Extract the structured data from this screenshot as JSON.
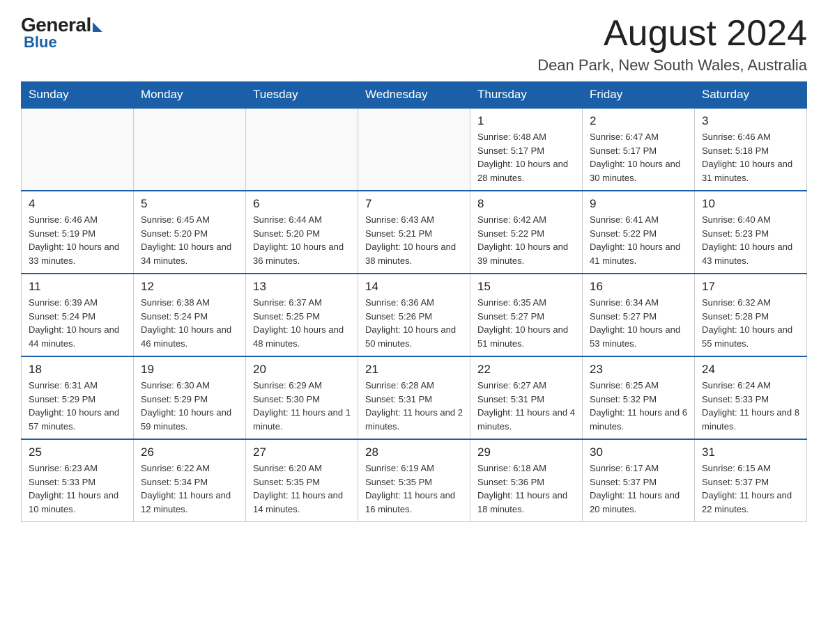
{
  "header": {
    "logo_general": "General",
    "logo_blue": "Blue",
    "month_title": "August 2024",
    "location": "Dean Park, New South Wales, Australia"
  },
  "days_of_week": [
    "Sunday",
    "Monday",
    "Tuesday",
    "Wednesday",
    "Thursday",
    "Friday",
    "Saturday"
  ],
  "weeks": [
    [
      {
        "day": "",
        "info": ""
      },
      {
        "day": "",
        "info": ""
      },
      {
        "day": "",
        "info": ""
      },
      {
        "day": "",
        "info": ""
      },
      {
        "day": "1",
        "info": "Sunrise: 6:48 AM\nSunset: 5:17 PM\nDaylight: 10 hours and 28 minutes."
      },
      {
        "day": "2",
        "info": "Sunrise: 6:47 AM\nSunset: 5:17 PM\nDaylight: 10 hours and 30 minutes."
      },
      {
        "day": "3",
        "info": "Sunrise: 6:46 AM\nSunset: 5:18 PM\nDaylight: 10 hours and 31 minutes."
      }
    ],
    [
      {
        "day": "4",
        "info": "Sunrise: 6:46 AM\nSunset: 5:19 PM\nDaylight: 10 hours and 33 minutes."
      },
      {
        "day": "5",
        "info": "Sunrise: 6:45 AM\nSunset: 5:20 PM\nDaylight: 10 hours and 34 minutes."
      },
      {
        "day": "6",
        "info": "Sunrise: 6:44 AM\nSunset: 5:20 PM\nDaylight: 10 hours and 36 minutes."
      },
      {
        "day": "7",
        "info": "Sunrise: 6:43 AM\nSunset: 5:21 PM\nDaylight: 10 hours and 38 minutes."
      },
      {
        "day": "8",
        "info": "Sunrise: 6:42 AM\nSunset: 5:22 PM\nDaylight: 10 hours and 39 minutes."
      },
      {
        "day": "9",
        "info": "Sunrise: 6:41 AM\nSunset: 5:22 PM\nDaylight: 10 hours and 41 minutes."
      },
      {
        "day": "10",
        "info": "Sunrise: 6:40 AM\nSunset: 5:23 PM\nDaylight: 10 hours and 43 minutes."
      }
    ],
    [
      {
        "day": "11",
        "info": "Sunrise: 6:39 AM\nSunset: 5:24 PM\nDaylight: 10 hours and 44 minutes."
      },
      {
        "day": "12",
        "info": "Sunrise: 6:38 AM\nSunset: 5:24 PM\nDaylight: 10 hours and 46 minutes."
      },
      {
        "day": "13",
        "info": "Sunrise: 6:37 AM\nSunset: 5:25 PM\nDaylight: 10 hours and 48 minutes."
      },
      {
        "day": "14",
        "info": "Sunrise: 6:36 AM\nSunset: 5:26 PM\nDaylight: 10 hours and 50 minutes."
      },
      {
        "day": "15",
        "info": "Sunrise: 6:35 AM\nSunset: 5:27 PM\nDaylight: 10 hours and 51 minutes."
      },
      {
        "day": "16",
        "info": "Sunrise: 6:34 AM\nSunset: 5:27 PM\nDaylight: 10 hours and 53 minutes."
      },
      {
        "day": "17",
        "info": "Sunrise: 6:32 AM\nSunset: 5:28 PM\nDaylight: 10 hours and 55 minutes."
      }
    ],
    [
      {
        "day": "18",
        "info": "Sunrise: 6:31 AM\nSunset: 5:29 PM\nDaylight: 10 hours and 57 minutes."
      },
      {
        "day": "19",
        "info": "Sunrise: 6:30 AM\nSunset: 5:29 PM\nDaylight: 10 hours and 59 minutes."
      },
      {
        "day": "20",
        "info": "Sunrise: 6:29 AM\nSunset: 5:30 PM\nDaylight: 11 hours and 1 minute."
      },
      {
        "day": "21",
        "info": "Sunrise: 6:28 AM\nSunset: 5:31 PM\nDaylight: 11 hours and 2 minutes."
      },
      {
        "day": "22",
        "info": "Sunrise: 6:27 AM\nSunset: 5:31 PM\nDaylight: 11 hours and 4 minutes."
      },
      {
        "day": "23",
        "info": "Sunrise: 6:25 AM\nSunset: 5:32 PM\nDaylight: 11 hours and 6 minutes."
      },
      {
        "day": "24",
        "info": "Sunrise: 6:24 AM\nSunset: 5:33 PM\nDaylight: 11 hours and 8 minutes."
      }
    ],
    [
      {
        "day": "25",
        "info": "Sunrise: 6:23 AM\nSunset: 5:33 PM\nDaylight: 11 hours and 10 minutes."
      },
      {
        "day": "26",
        "info": "Sunrise: 6:22 AM\nSunset: 5:34 PM\nDaylight: 11 hours and 12 minutes."
      },
      {
        "day": "27",
        "info": "Sunrise: 6:20 AM\nSunset: 5:35 PM\nDaylight: 11 hours and 14 minutes."
      },
      {
        "day": "28",
        "info": "Sunrise: 6:19 AM\nSunset: 5:35 PM\nDaylight: 11 hours and 16 minutes."
      },
      {
        "day": "29",
        "info": "Sunrise: 6:18 AM\nSunset: 5:36 PM\nDaylight: 11 hours and 18 minutes."
      },
      {
        "day": "30",
        "info": "Sunrise: 6:17 AM\nSunset: 5:37 PM\nDaylight: 11 hours and 20 minutes."
      },
      {
        "day": "31",
        "info": "Sunrise: 6:15 AM\nSunset: 5:37 PM\nDaylight: 11 hours and 22 minutes."
      }
    ]
  ]
}
